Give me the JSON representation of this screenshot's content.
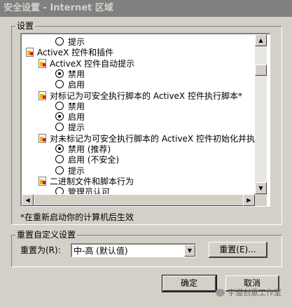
{
  "window": {
    "title": "安全设置 - Internet 区域"
  },
  "settings_group": {
    "legend": "设置",
    "items": [
      {
        "type": "radio",
        "label": "提示",
        "checked": false,
        "level": 2
      },
      {
        "type": "category",
        "label": "ActiveX 控件和插件",
        "level": 0
      },
      {
        "type": "category",
        "label": "ActiveX 控件自动提示",
        "level": 1
      },
      {
        "type": "radio",
        "label": "禁用",
        "checked": true,
        "level": 2
      },
      {
        "type": "radio",
        "label": "启用",
        "checked": false,
        "level": 2
      },
      {
        "type": "category",
        "label": "对标记为可安全执行脚本的 ActiveX 控件执行脚本*",
        "level": 1
      },
      {
        "type": "radio",
        "label": "禁用",
        "checked": false,
        "level": 2
      },
      {
        "type": "radio",
        "label": "启用",
        "checked": true,
        "level": 2
      },
      {
        "type": "radio",
        "label": "提示",
        "checked": false,
        "level": 2
      },
      {
        "type": "category",
        "label": "对未标记为可安全执行脚本的 ActiveX 控件初始化并执",
        "level": 1
      },
      {
        "type": "radio",
        "label": "禁用 (推荐)",
        "checked": true,
        "level": 2
      },
      {
        "type": "radio",
        "label": "启用 (不安全)",
        "checked": false,
        "level": 2
      },
      {
        "type": "radio",
        "label": "提示",
        "checked": false,
        "level": 2
      },
      {
        "type": "category",
        "label": "二进制文件和脚本行为",
        "level": 1
      },
      {
        "type": "radio",
        "label": "管理员认可",
        "checked": false,
        "level": 2
      }
    ],
    "note": "*在重新启动你的计算机后生效"
  },
  "reset_group": {
    "legend": "重置自定义设置",
    "reset_to_label": "重置为(R):",
    "selected_level": "中-高 (默认值)",
    "reset_button": "重置(E)..."
  },
  "buttons": {
    "ok": "确定",
    "cancel": "取消"
  },
  "watermark": "宇道创意工作室"
}
